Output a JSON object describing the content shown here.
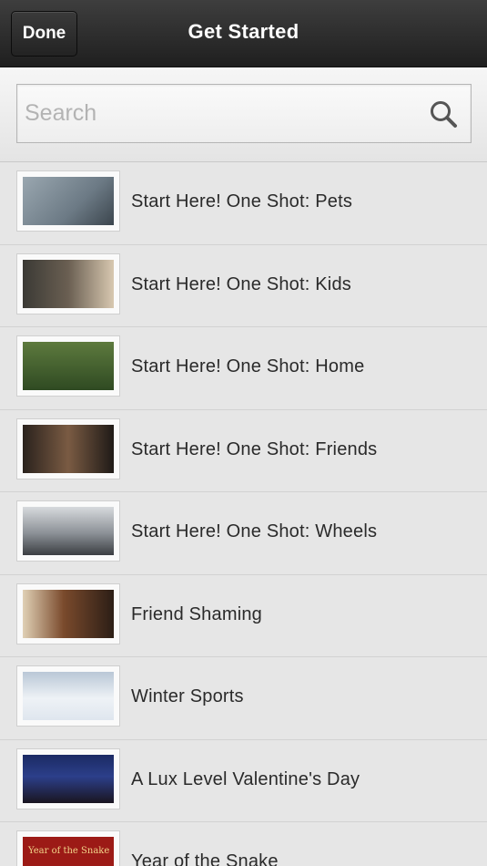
{
  "navbar": {
    "done_label": "Done",
    "title": "Get Started"
  },
  "search": {
    "placeholder": "Search",
    "value": "",
    "icon": "search-icon"
  },
  "items": [
    {
      "label": "Start Here! One Shot: Pets",
      "thumb": "pets"
    },
    {
      "label": "Start Here! One Shot: Kids",
      "thumb": "kids"
    },
    {
      "label": "Start Here! One Shot: Home",
      "thumb": "home"
    },
    {
      "label": "Start Here! One Shot: Friends",
      "thumb": "friends"
    },
    {
      "label": "Start Here! One Shot: Wheels",
      "thumb": "wheels"
    },
    {
      "label": "Friend Shaming",
      "thumb": "shaming"
    },
    {
      "label": "Winter Sports",
      "thumb": "winter"
    },
    {
      "label": "A Lux Level Valentine's Day",
      "thumb": "lux"
    },
    {
      "label": "Year of the Snake",
      "thumb": "snake",
      "thumb_text": "Year of the Snake"
    }
  ],
  "colors": {
    "navbar": "#2b2b2b",
    "background": "#e6e6e6",
    "text": "#2a2a2a"
  }
}
